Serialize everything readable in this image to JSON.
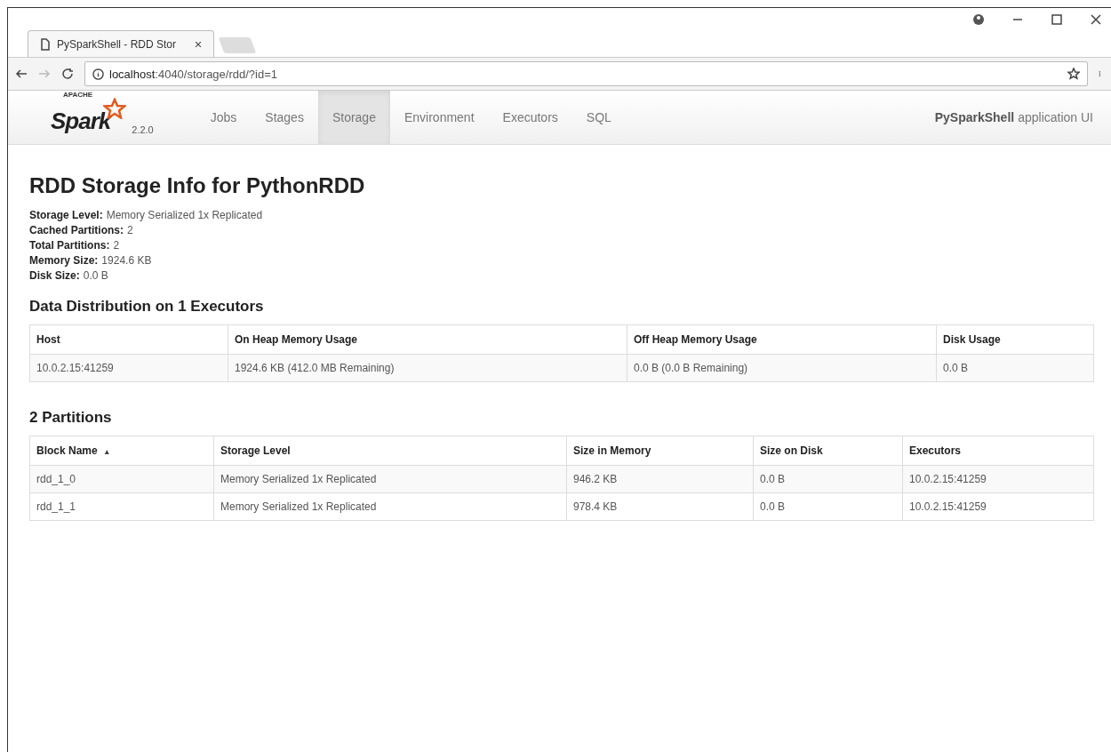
{
  "browser": {
    "tab_title": "PySparkShell - RDD Stor",
    "url_host": "localhost",
    "url_path": ":4040/storage/rdd/?id=1"
  },
  "navbar": {
    "logo_small": "APACHE",
    "logo": "Spark",
    "version": "2.2.0",
    "items": [
      {
        "label": "Jobs",
        "selected": false
      },
      {
        "label": "Stages",
        "selected": false
      },
      {
        "label": "Storage",
        "selected": true
      },
      {
        "label": "Environment",
        "selected": false
      },
      {
        "label": "Executors",
        "selected": false
      },
      {
        "label": "SQL",
        "selected": false
      }
    ],
    "app_name": "PySparkShell",
    "app_suffix": "application UI"
  },
  "title": "RDD Storage Info for PythonRDD",
  "summary": [
    {
      "label": "Storage Level:",
      "value": "Memory Serialized 1x Replicated"
    },
    {
      "label": "Cached Partitions:",
      "value": "2"
    },
    {
      "label": "Total Partitions:",
      "value": "2"
    },
    {
      "label": "Memory Size:",
      "value": "1924.6 KB"
    },
    {
      "label": "Disk Size:",
      "value": "0.0 B"
    }
  ],
  "distribution": {
    "heading": "Data Distribution on 1 Executors",
    "columns": [
      "Host",
      "On Heap Memory Usage",
      "Off Heap Memory Usage",
      "Disk Usage"
    ],
    "rows": [
      [
        "10.0.2.15:41259",
        "1924.6 KB (412.0 MB Remaining)",
        "0.0 B (0.0 B Remaining)",
        "0.0 B"
      ]
    ]
  },
  "partitions": {
    "heading": "2 Partitions",
    "sort_mark": "▴",
    "columns": [
      "Block Name",
      "Storage Level",
      "Size in Memory",
      "Size on Disk",
      "Executors"
    ],
    "rows": [
      [
        "rdd_1_0",
        "Memory Serialized 1x Replicated",
        "946.2 KB",
        "0.0 B",
        "10.0.2.15:41259"
      ],
      [
        "rdd_1_1",
        "Memory Serialized 1x Replicated",
        "978.4 KB",
        "0.0 B",
        "10.0.2.15:41259"
      ]
    ]
  }
}
